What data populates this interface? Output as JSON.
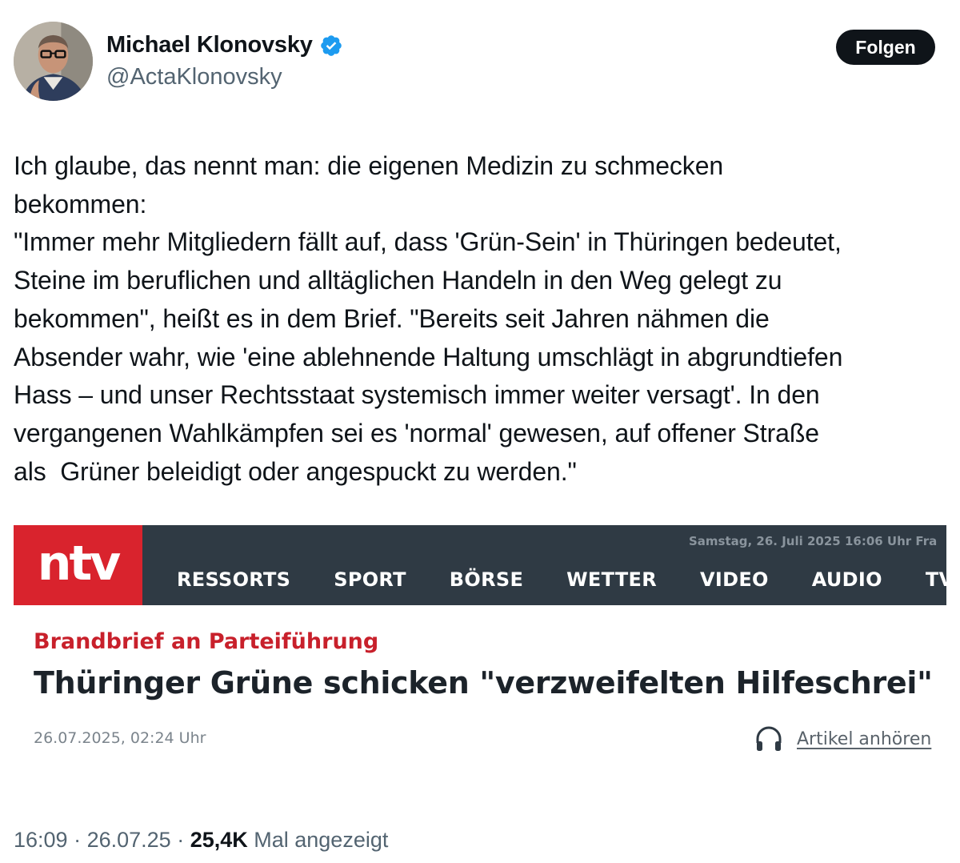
{
  "author": {
    "name": "Michael Klonovsky",
    "handle": "@ActaKlonovsky",
    "verified": true,
    "avatar_icon": "profile-photo"
  },
  "follow_button": {
    "label": "Folgen"
  },
  "tweet": {
    "text": "Ich glaube, das nennt man: die eigenen Medizin zu schmecken\nbekommen:\n\"Immer mehr Mitgliedern fällt auf, dass 'Grün-Sein' in Thüringen bedeutet,\nSteine im beruflichen und alltäglichen Handeln in den Weg gelegt zu\nbekommen\", heißt es in dem Brief. \"Bereits seit Jahren nähmen die\nAbsender wahr, wie 'eine ablehnende Haltung umschlägt in abgrundtiefen\nHass – und unser Rechtsstaat systemisch immer weiter versagt'. In den\nvergangenen Wahlkämpfen sei es 'normal' gewesen, auf offener Straße\nals  Grüner beleidigt oder angespuckt zu werden.\""
  },
  "article_card": {
    "logo_text": "ntv",
    "date_line": "Samstag, 26. Juli 2025 16:06 Uhr Fra",
    "nav_items": [
      "RESSORTS",
      "SPORT",
      "BÖRSE",
      "WETTER",
      "VIDEO",
      "AUDIO",
      "TV PRO"
    ],
    "kicker": "Brandbrief an Parteiführung",
    "headline": "Thüringer Grüne schicken \"verzweifelten Hilfeschrei\"",
    "timestamp": "26.07.2025, 02:24 Uhr",
    "listen_label": "Artikel anhören",
    "listen_icon": "headphones-icon"
  },
  "meta": {
    "time": "16:09",
    "separator": " · ",
    "date": "26.07.25",
    "views": "25,4K",
    "views_label": " Mal angezeigt"
  },
  "colors": {
    "follow_bg": "#0f1419",
    "verified": "#1d9bf0",
    "ntv_red": "#d9232d",
    "ntv_bar": "#2f3a44",
    "kicker": "#c8202b"
  }
}
